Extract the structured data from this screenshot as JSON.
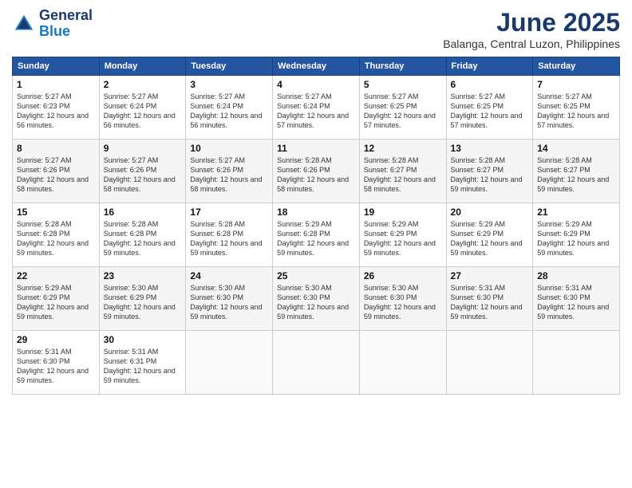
{
  "header": {
    "logo_line1": "General",
    "logo_line2": "Blue",
    "month": "June 2025",
    "location": "Balanga, Central Luzon, Philippines"
  },
  "weekdays": [
    "Sunday",
    "Monday",
    "Tuesday",
    "Wednesday",
    "Thursday",
    "Friday",
    "Saturday"
  ],
  "weeks": [
    [
      {
        "day": "1",
        "sunrise": "5:27 AM",
        "sunset": "6:23 PM",
        "daylight": "12 hours and 56 minutes."
      },
      {
        "day": "2",
        "sunrise": "5:27 AM",
        "sunset": "6:24 PM",
        "daylight": "12 hours and 56 minutes."
      },
      {
        "day": "3",
        "sunrise": "5:27 AM",
        "sunset": "6:24 PM",
        "daylight": "12 hours and 56 minutes."
      },
      {
        "day": "4",
        "sunrise": "5:27 AM",
        "sunset": "6:24 PM",
        "daylight": "12 hours and 57 minutes."
      },
      {
        "day": "5",
        "sunrise": "5:27 AM",
        "sunset": "6:25 PM",
        "daylight": "12 hours and 57 minutes."
      },
      {
        "day": "6",
        "sunrise": "5:27 AM",
        "sunset": "6:25 PM",
        "daylight": "12 hours and 57 minutes."
      },
      {
        "day": "7",
        "sunrise": "5:27 AM",
        "sunset": "6:25 PM",
        "daylight": "12 hours and 57 minutes."
      }
    ],
    [
      {
        "day": "8",
        "sunrise": "5:27 AM",
        "sunset": "6:26 PM",
        "daylight": "12 hours and 58 minutes."
      },
      {
        "day": "9",
        "sunrise": "5:27 AM",
        "sunset": "6:26 PM",
        "daylight": "12 hours and 58 minutes."
      },
      {
        "day": "10",
        "sunrise": "5:27 AM",
        "sunset": "6:26 PM",
        "daylight": "12 hours and 58 minutes."
      },
      {
        "day": "11",
        "sunrise": "5:28 AM",
        "sunset": "6:26 PM",
        "daylight": "12 hours and 58 minutes."
      },
      {
        "day": "12",
        "sunrise": "5:28 AM",
        "sunset": "6:27 PM",
        "daylight": "12 hours and 58 minutes."
      },
      {
        "day": "13",
        "sunrise": "5:28 AM",
        "sunset": "6:27 PM",
        "daylight": "12 hours and 59 minutes."
      },
      {
        "day": "14",
        "sunrise": "5:28 AM",
        "sunset": "6:27 PM",
        "daylight": "12 hours and 59 minutes."
      }
    ],
    [
      {
        "day": "15",
        "sunrise": "5:28 AM",
        "sunset": "6:28 PM",
        "daylight": "12 hours and 59 minutes."
      },
      {
        "day": "16",
        "sunrise": "5:28 AM",
        "sunset": "6:28 PM",
        "daylight": "12 hours and 59 minutes."
      },
      {
        "day": "17",
        "sunrise": "5:28 AM",
        "sunset": "6:28 PM",
        "daylight": "12 hours and 59 minutes."
      },
      {
        "day": "18",
        "sunrise": "5:29 AM",
        "sunset": "6:28 PM",
        "daylight": "12 hours and 59 minutes."
      },
      {
        "day": "19",
        "sunrise": "5:29 AM",
        "sunset": "6:29 PM",
        "daylight": "12 hours and 59 minutes."
      },
      {
        "day": "20",
        "sunrise": "5:29 AM",
        "sunset": "6:29 PM",
        "daylight": "12 hours and 59 minutes."
      },
      {
        "day": "21",
        "sunrise": "5:29 AM",
        "sunset": "6:29 PM",
        "daylight": "12 hours and 59 minutes."
      }
    ],
    [
      {
        "day": "22",
        "sunrise": "5:29 AM",
        "sunset": "6:29 PM",
        "daylight": "12 hours and 59 minutes."
      },
      {
        "day": "23",
        "sunrise": "5:30 AM",
        "sunset": "6:29 PM",
        "daylight": "12 hours and 59 minutes."
      },
      {
        "day": "24",
        "sunrise": "5:30 AM",
        "sunset": "6:30 PM",
        "daylight": "12 hours and 59 minutes."
      },
      {
        "day": "25",
        "sunrise": "5:30 AM",
        "sunset": "6:30 PM",
        "daylight": "12 hours and 59 minutes."
      },
      {
        "day": "26",
        "sunrise": "5:30 AM",
        "sunset": "6:30 PM",
        "daylight": "12 hours and 59 minutes."
      },
      {
        "day": "27",
        "sunrise": "5:31 AM",
        "sunset": "6:30 PM",
        "daylight": "12 hours and 59 minutes."
      },
      {
        "day": "28",
        "sunrise": "5:31 AM",
        "sunset": "6:30 PM",
        "daylight": "12 hours and 59 minutes."
      }
    ],
    [
      {
        "day": "29",
        "sunrise": "5:31 AM",
        "sunset": "6:30 PM",
        "daylight": "12 hours and 59 minutes."
      },
      {
        "day": "30",
        "sunrise": "5:31 AM",
        "sunset": "6:31 PM",
        "daylight": "12 hours and 59 minutes."
      },
      null,
      null,
      null,
      null,
      null
    ]
  ]
}
